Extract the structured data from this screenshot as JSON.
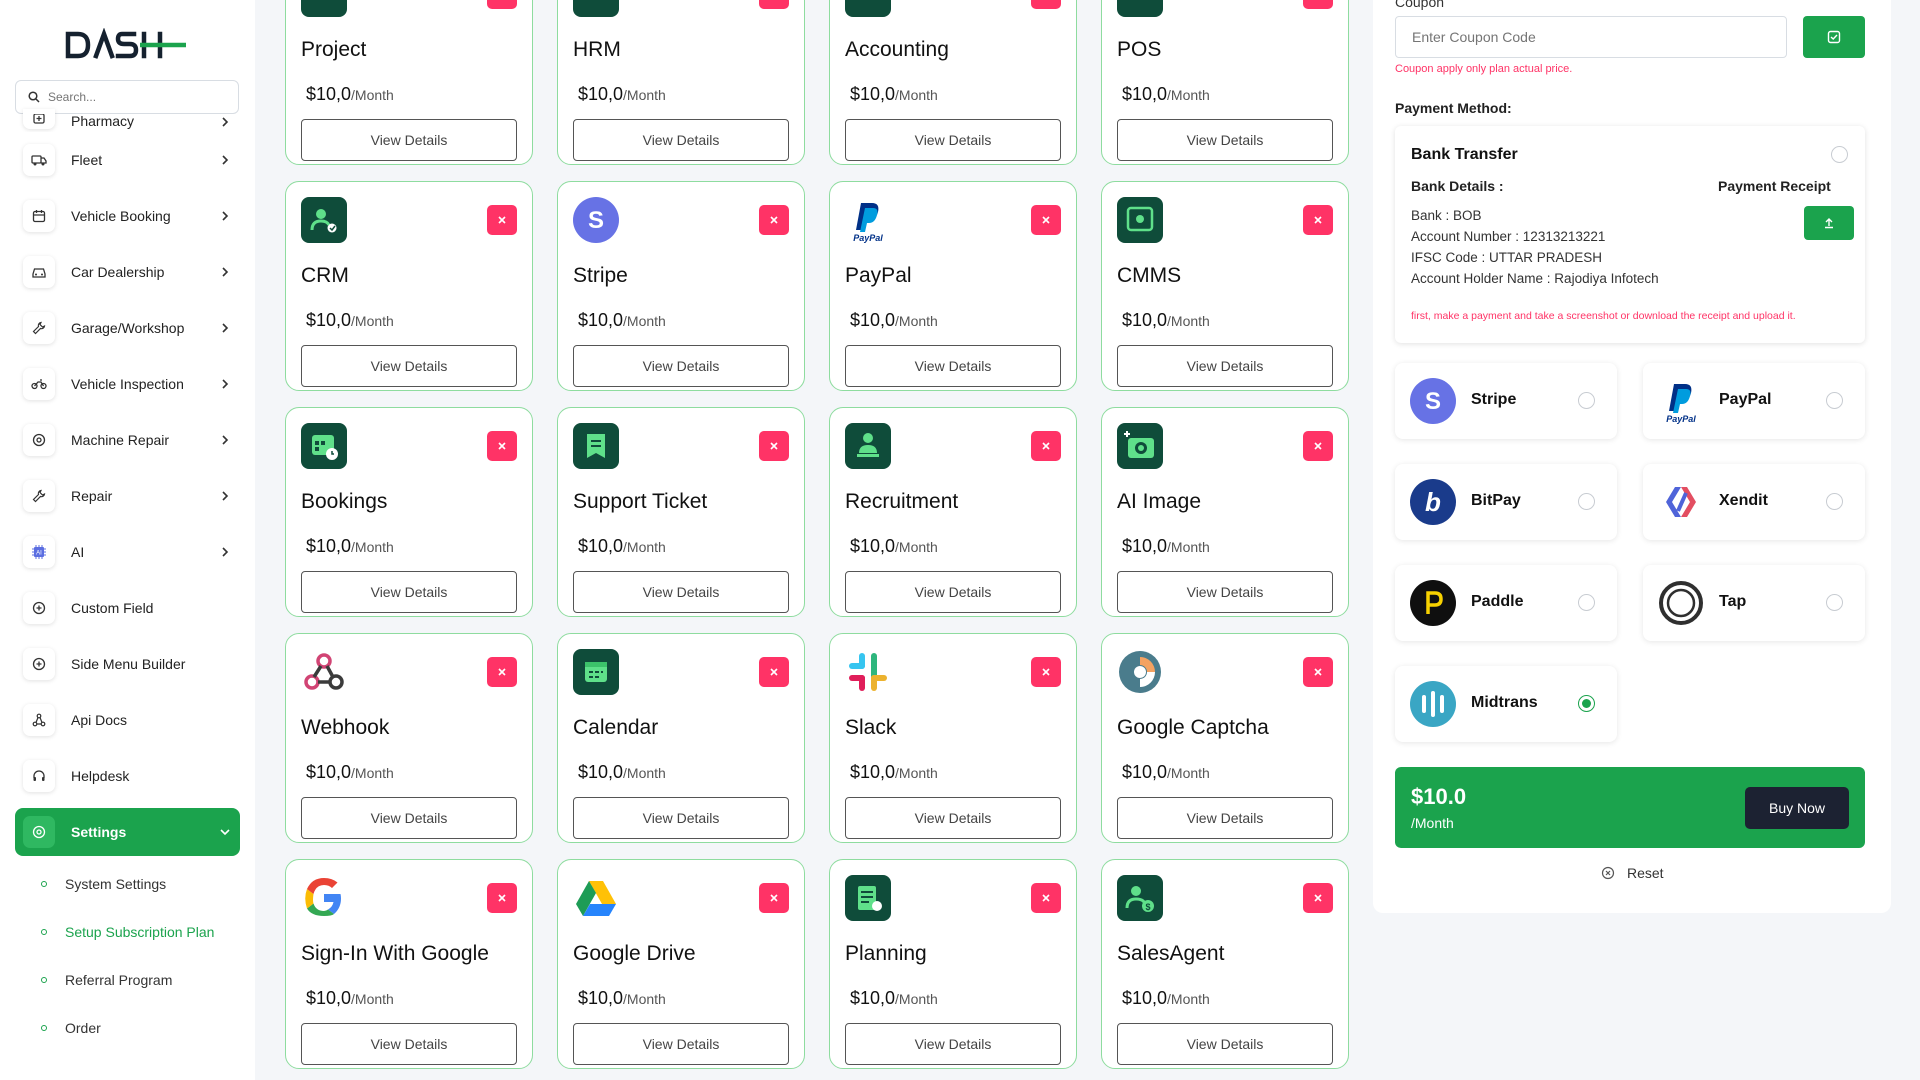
{
  "brand": {
    "logo_text": "DASH"
  },
  "search": {
    "placeholder": "Search..."
  },
  "sidebar": {
    "items": [
      {
        "label": "Pharmacy",
        "icon": "pharmacy-icon"
      },
      {
        "label": "Fleet",
        "icon": "truck-icon"
      },
      {
        "label": "Vehicle Booking",
        "icon": "calendar-icon"
      },
      {
        "label": "Car Dealership",
        "icon": "car-icon"
      },
      {
        "label": "Garage/Workshop",
        "icon": "wrench-icon"
      },
      {
        "label": "Vehicle Inspection",
        "icon": "motorbike-icon"
      },
      {
        "label": "Machine Repair",
        "icon": "gear-icon"
      },
      {
        "label": "Repair",
        "icon": "tools-icon"
      },
      {
        "label": "AI",
        "icon": "ai-chip-icon"
      },
      {
        "label": "Custom Field",
        "icon": "plus-circle-icon"
      },
      {
        "label": "Side Menu Builder",
        "icon": "plus-circle-icon"
      },
      {
        "label": "Api Docs",
        "icon": "api-icon"
      },
      {
        "label": "Helpdesk",
        "icon": "headset-icon"
      }
    ],
    "active": {
      "label": "Settings",
      "icon": "gear-icon"
    },
    "submenu": [
      {
        "label": "System Settings",
        "active": false
      },
      {
        "label": "Setup Subscription Plan",
        "active": true
      },
      {
        "label": "Referral Program",
        "active": false
      },
      {
        "label": "Order",
        "active": false
      }
    ]
  },
  "plans": {
    "price": "$10,0",
    "per": "/Month",
    "button_label": "View Details",
    "cards": [
      {
        "title": "Project",
        "icon": "project-icon"
      },
      {
        "title": "HRM",
        "icon": "hrm-icon"
      },
      {
        "title": "Accounting",
        "icon": "accounting-icon"
      },
      {
        "title": "POS",
        "icon": "pos-icon"
      },
      {
        "title": "CRM",
        "icon": "crm-icon"
      },
      {
        "title": "Stripe",
        "icon": "stripe-icon"
      },
      {
        "title": "PayPal",
        "icon": "paypal-icon"
      },
      {
        "title": "CMMS",
        "icon": "cmms-icon"
      },
      {
        "title": "Bookings",
        "icon": "bookings-icon"
      },
      {
        "title": "Support Ticket",
        "icon": "ticket-icon"
      },
      {
        "title": "Recruitment",
        "icon": "recruitment-icon"
      },
      {
        "title": "AI Image",
        "icon": "camera-icon"
      },
      {
        "title": "Webhook",
        "icon": "webhook-icon"
      },
      {
        "title": "Calendar",
        "icon": "calendar-icon"
      },
      {
        "title": "Slack",
        "icon": "slack-icon"
      },
      {
        "title": "Google Captcha",
        "icon": "captcha-icon"
      },
      {
        "title": "Sign-In With Google",
        "icon": "google-icon"
      },
      {
        "title": "Google Drive",
        "icon": "google-drive-icon"
      },
      {
        "title": "Planning",
        "icon": "planning-icon"
      },
      {
        "title": "SalesAgent",
        "icon": "sales-agent-icon"
      }
    ]
  },
  "checkout": {
    "coupon_label": "Coupon",
    "coupon_placeholder": "Enter Coupon Code",
    "coupon_note": "Coupon apply only plan actual price.",
    "payment_method_label": "Payment Method:",
    "bank": {
      "title": "Bank Transfer",
      "details_label": "Bank Details :",
      "receipt_label": "Payment Receipt",
      "lines": [
        "Bank : BOB",
        "Account Number : 12313213221",
        "IFSC Code : UTTAR PRADESH",
        "Account Holder Name : Rajodiya Infotech"
      ],
      "note": "first, make a payment and take a screenshot or download the receipt and upload it."
    },
    "gateways": [
      {
        "name": "Stripe",
        "icon": "stripe-icon",
        "selected": false
      },
      {
        "name": "PayPal",
        "icon": "paypal-icon",
        "selected": false
      },
      {
        "name": "BitPay",
        "icon": "bitpay-icon",
        "selected": false
      },
      {
        "name": "Xendit",
        "icon": "xendit-icon",
        "selected": false
      },
      {
        "name": "Paddle",
        "icon": "paddle-icon",
        "selected": false
      },
      {
        "name": "Tap",
        "icon": "tap-icon",
        "selected": false
      },
      {
        "name": "Midtrans",
        "icon": "midtrans-icon",
        "selected": true
      }
    ],
    "total_price": "$10.0",
    "total_per": "/Month",
    "buy_label": "Buy Now",
    "reset_label": "Reset"
  },
  "colors": {
    "accent": "#1ba34d",
    "danger": "#ff3366",
    "card_border": "#8edc9f",
    "dark": "#1c2232"
  }
}
